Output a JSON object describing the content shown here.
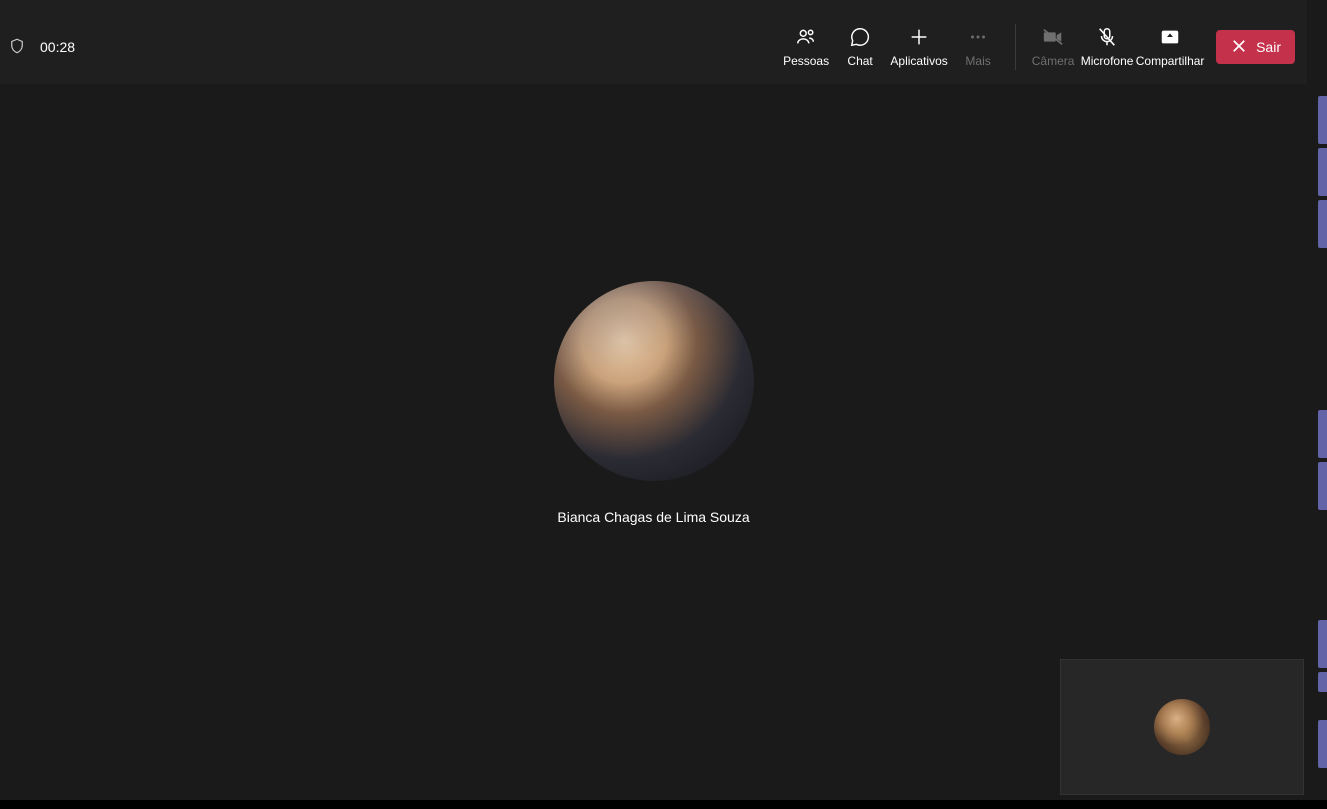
{
  "timer": "00:28",
  "toolbar": {
    "people": "Pessoas",
    "chat": "Chat",
    "apps": "Aplicativos",
    "more": "Mais",
    "camera": "Câmera",
    "mic": "Microfone",
    "share": "Compartilhar",
    "leave": "Sair"
  },
  "participant": {
    "name": "Bianca Chagas de Lima Souza"
  },
  "colors": {
    "leave": "#c4314b",
    "accent": "#6264a7",
    "bg_stage": "#1a1a1a",
    "bg_bar": "#1f1f1f"
  },
  "states": {
    "camera_off": true,
    "mic_muted": true,
    "more_disabled": true
  }
}
